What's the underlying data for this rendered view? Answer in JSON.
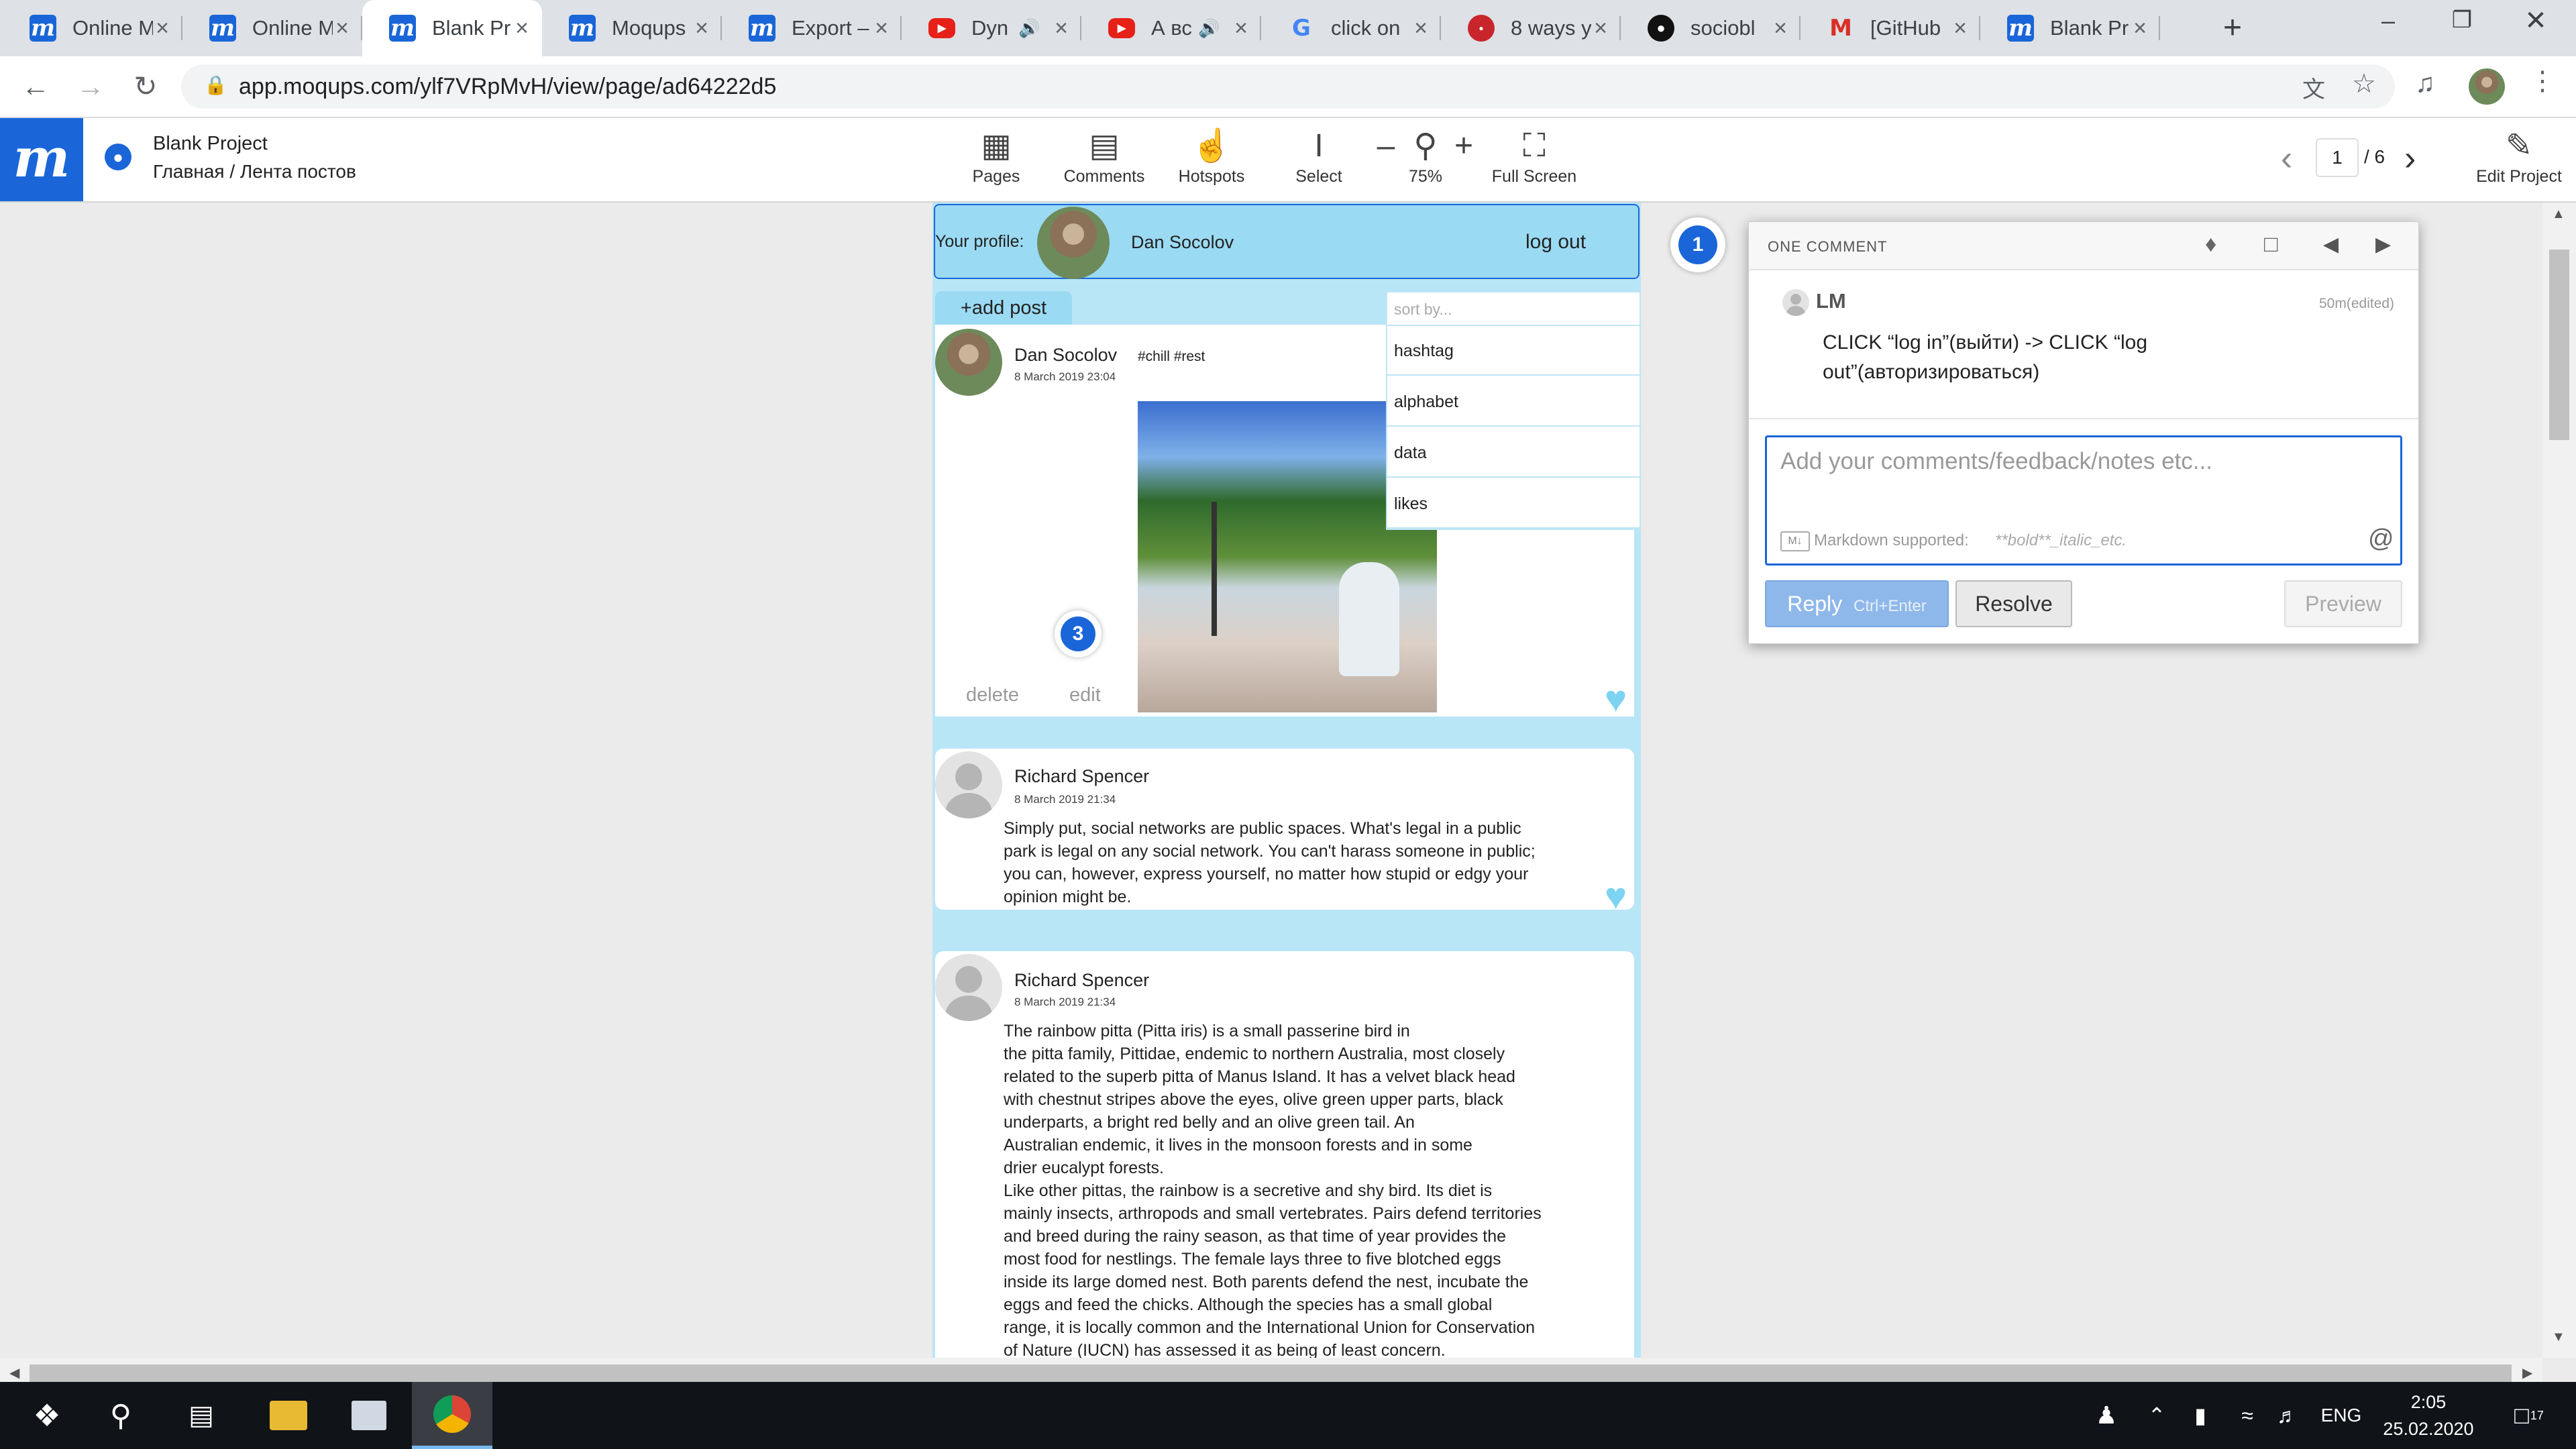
{
  "browser": {
    "tabs": [
      {
        "icon": "moqups-favicon",
        "title": "Online M",
        "active": false
      },
      {
        "icon": "moqups-favicon",
        "title": "Online M",
        "active": false
      },
      {
        "icon": "moqups-favicon",
        "title": "Blank Pr",
        "active": true
      },
      {
        "icon": "moqups-favicon",
        "title": "Moqups",
        "active": false
      },
      {
        "icon": "moqups-favicon",
        "title": "Export –",
        "active": false
      },
      {
        "icon": "youtube-favicon",
        "title": "Dyn",
        "active": false,
        "audio": true
      },
      {
        "icon": "youtube-favicon",
        "title": "А вс",
        "active": false,
        "audio": true
      },
      {
        "icon": "google-favicon",
        "title": "click on",
        "active": false
      },
      {
        "icon": "red-favicon",
        "title": "8 ways y",
        "active": false
      },
      {
        "icon": "github-favicon",
        "title": "sociobl",
        "active": false
      },
      {
        "icon": "gmail-favicon",
        "title": "[GitHub",
        "active": false
      },
      {
        "icon": "moqups-favicon",
        "title": "Blank Pr",
        "active": false
      }
    ],
    "url": "app.moqups.com/ylf7VRpMvH/view/page/ad64222d5"
  },
  "moqups": {
    "project_title": "Blank Project",
    "breadcrumb": "Главная / Лента постов",
    "toolbar": {
      "pages": "Pages",
      "comments": "Comments",
      "hotspots": "Hotspots",
      "select": "Select",
      "zoom": "75%",
      "fullscreen": "Full Screen"
    },
    "pager": {
      "current": "1",
      "total": "/ 6"
    },
    "edit_project": "Edit Project"
  },
  "mockup": {
    "profile_label": "Your profile:",
    "profile_name": "Dan Socolov",
    "logout": "log out",
    "add_post": "+add post",
    "sort_placeholder": "sort by...",
    "sort_options": [
      "hashtag",
      "alphabet",
      "data",
      "likes"
    ],
    "posts": [
      {
        "author": "Dan Socolov",
        "date": "8 March 2019 23:04",
        "tags": "#chill #rest",
        "delete": "delete",
        "edit": "edit"
      },
      {
        "author": "Richard Spencer",
        "date": "8 March 2019 21:34",
        "text_lines": [
          "Simply put, social networks are public spaces. What's legal in a public",
          "park is legal on any social network. You can't harass someone in public;",
          "you can, however, express yourself, no matter how stupid or edgy your",
          "opinion might be."
        ]
      },
      {
        "author": "Richard Spencer",
        "date": "8 March 2019 21:34",
        "text_lines": [
          "The rainbow pitta (Pitta iris) is a small passerine bird in",
          "the pitta family, Pittidae, endemic to northern Australia, most closely",
          "related to the superb pitta of Manus Island. It has a velvet black head",
          "with chestnut stripes above the eyes, olive green upper parts, black",
          "underparts, a bright red belly and an olive green tail. An",
          "Australian endemic, it lives in the monsoon forests and in some",
          "drier eucalypt forests.",
          "Like other pittas, the rainbow is a secretive and shy bird. Its diet is",
          "mainly insects, arthropods and small vertebrates. Pairs defend territories",
          "and breed during the rainy season, as that time of year provides the",
          "most food for nestlings. The female lays three to five blotched eggs",
          "inside its large domed nest. Both parents defend the nest, incubate the",
          "eggs and feed the chicks. Although the species has a small global",
          "range, it is locally common and the International Union for Conservation",
          "of Nature (IUCN) has assessed it as being of least concern."
        ]
      }
    ],
    "hotspot_markers": {
      "comment_pin": "1",
      "post_pin": "3"
    }
  },
  "comment_panel": {
    "header": "ONE COMMENT",
    "author": "LM",
    "time": "50m(edited)",
    "text_line1": "CLICK “log in”(выйти) -> CLICK “log",
    "text_line2": "out”(авторизироваться)",
    "input_placeholder": "Add your comments/feedback/notes etc...",
    "markdown_label": "Markdown supported:",
    "markdown_hint": "**bold**_italic_etc.",
    "reply": "Reply",
    "reply_shortcut": "Ctrl+Enter",
    "resolve": "Resolve",
    "preview": "Preview"
  },
  "taskbar": {
    "language": "ENG",
    "time": "2:05",
    "date": "25.02.2020",
    "notifications": "17"
  },
  "colors": {
    "moqups_blue": "#1a66d8",
    "mockup_light_blue": "#b9e6f7",
    "heart": "#7dd3f2",
    "reply_button": "#8fb8ea"
  }
}
